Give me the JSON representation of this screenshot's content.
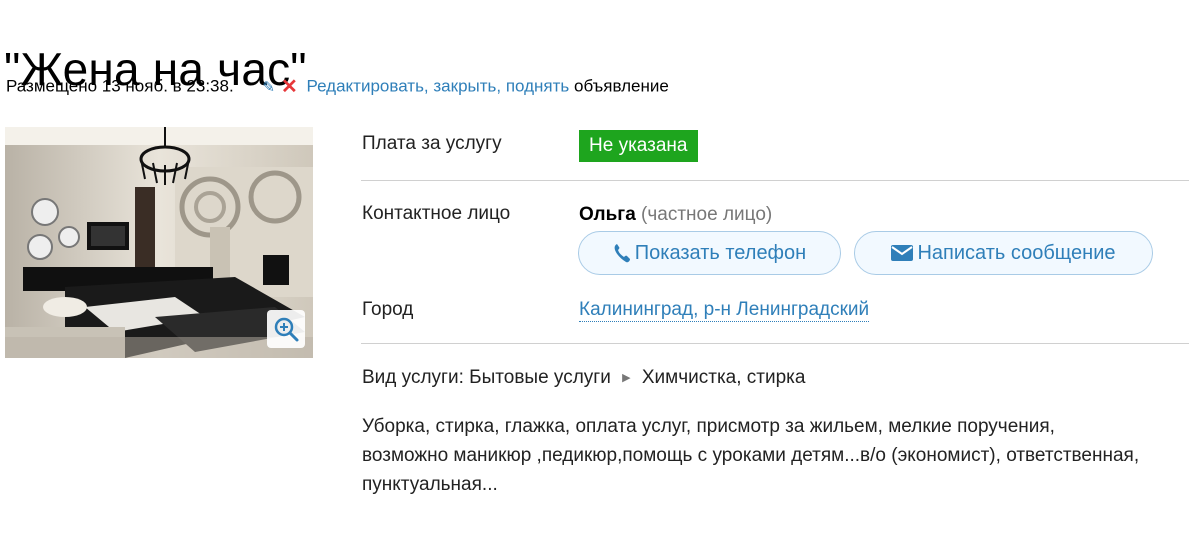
{
  "ad": {
    "title": "\"Жена на час\"",
    "posted": "Размещено 13 нояб. в 23:38.",
    "edit_links": "Редактировать, закрыть, поднять",
    "edit_suffix": "объявление"
  },
  "details": {
    "price_label": "Плата за услугу",
    "price_value": "Не указана",
    "contact_label": "Контактное лицо",
    "contact_name": "Ольга",
    "contact_type": "(частное лицо)",
    "show_phone": "Показать телефон",
    "send_message": "Написать сообщение",
    "city_label": "Город",
    "city_value": "Калининград, р-н Ленинградский"
  },
  "service": {
    "prefix": "Вид услуги:",
    "category": "Бытовые услуги",
    "subcategory": "Химчистка, стирка"
  },
  "description": "Уборка, стирка, глажка, оплата услуг, присмотр за жильем, мелкие поручения, возможно маникюр ,педикюр,помощь с уроками детям...в/о (экономист), ответственная, пунктуальная...",
  "colors": {
    "link": "#2f7fb9",
    "badge": "#1ea51e",
    "close": "#e6373a"
  },
  "icons": {
    "edit": "pencil-icon",
    "close": "close-icon",
    "phone": "phone-icon",
    "message": "envelope-icon",
    "zoom": "zoom-in-icon"
  }
}
